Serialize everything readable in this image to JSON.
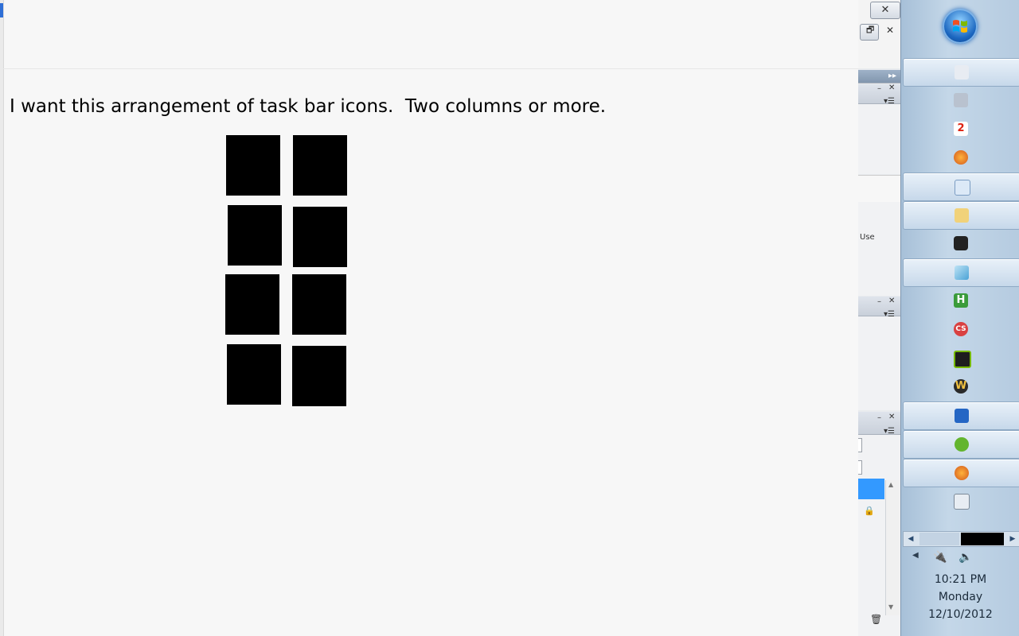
{
  "note": "I want this arrangement of task bar icons.  Two columns or more.",
  "side_panel": {
    "use_label": "Use"
  },
  "clock": {
    "time": "10:21 PM",
    "day": "Monday",
    "date": "12/10/2012"
  },
  "taskbar": {
    "items": [
      {
        "icon": "gamepad-icon",
        "selected": true
      },
      {
        "icon": "game-controller-icon",
        "selected": false
      },
      {
        "icon": "app-2-icon",
        "glyph": "2",
        "selected": false
      },
      {
        "icon": "firefox-icon",
        "selected": false
      },
      {
        "icon": "image-viewer-icon",
        "selected": true
      },
      {
        "icon": "folder-icon",
        "selected": true
      },
      {
        "icon": "steam-icon",
        "selected": false
      },
      {
        "icon": "paint-icon",
        "selected": true
      },
      {
        "icon": "hexchat-icon",
        "glyph": "H",
        "selected": false
      },
      {
        "icon": "cs-icon",
        "glyph": "CS",
        "selected": false
      },
      {
        "icon": "nvidia-icon",
        "selected": false
      },
      {
        "icon": "wow-icon",
        "glyph": "W",
        "selected": false
      },
      {
        "icon": "mail-icon",
        "selected": true
      },
      {
        "icon": "spotify-icon",
        "selected": true
      },
      {
        "icon": "firefox-2-icon",
        "selected": true
      },
      {
        "icon": "window-icon",
        "selected": false
      }
    ]
  },
  "colors": {
    "highlight": "#3399ff",
    "canvas": "#f7f7f7"
  }
}
